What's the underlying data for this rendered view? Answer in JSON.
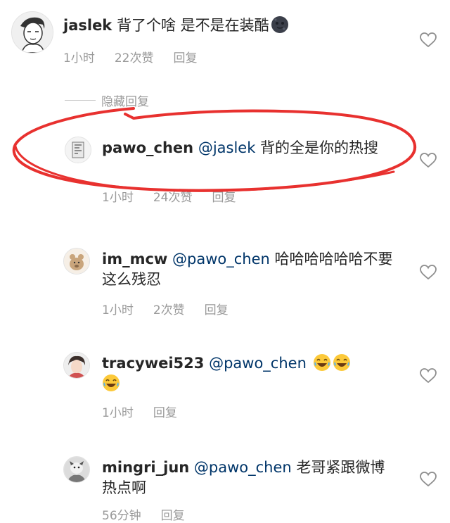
{
  "comments": [
    {
      "username": "jaslek",
      "mention": "",
      "text": " 背了个啥 是不是在装酷",
      "time": "1小时",
      "likes": "22次赞",
      "reply_label": "回复",
      "emoji": "dark-moon-face"
    },
    {
      "username": "pawo_chen",
      "mention": "@jaslek",
      "text": " 背的全是你的热搜",
      "time": "1小时",
      "likes": "24次赞",
      "reply_label": "回复"
    },
    {
      "username": "im_mcw",
      "mention": "@pawo_chen",
      "text": " 哈哈哈哈哈哈不要这么残忍",
      "time": "1小时",
      "likes": "2次赞",
      "reply_label": "回复"
    },
    {
      "username": "tracywei523",
      "mention": "@pawo_chen",
      "text": "",
      "time": "1小时",
      "likes": "",
      "reply_label": "回复",
      "emoji": "face-with-tears-of-joy"
    },
    {
      "username": "mingri_jun",
      "mention": "@pawo_chen",
      "text": " 老哥紧跟微博热点啊",
      "time": "56分钟",
      "likes": "",
      "reply_label": "回复"
    }
  ],
  "hide_replies_label": "隐藏回复",
  "colors": {
    "mention": "#003569",
    "meta": "#999999",
    "annotation": "#e8312f"
  }
}
